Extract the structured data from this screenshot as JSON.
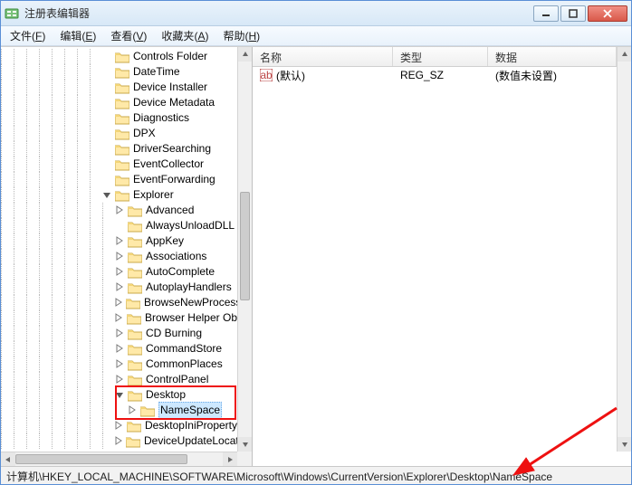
{
  "window": {
    "title": "注册表编辑器"
  },
  "menu": {
    "file": {
      "label": "文件",
      "key": "F"
    },
    "edit": {
      "label": "编辑",
      "key": "E"
    },
    "view": {
      "label": "查看",
      "key": "V"
    },
    "fav": {
      "label": "收藏夹",
      "key": "A"
    },
    "help": {
      "label": "帮助",
      "key": "H"
    }
  },
  "tree": {
    "root_indent": 8,
    "nodes": [
      {
        "depth": 8,
        "exp": "leaf",
        "label": "Controls Folder"
      },
      {
        "depth": 8,
        "exp": "leaf",
        "label": "DateTime"
      },
      {
        "depth": 8,
        "exp": "leaf",
        "label": "Device Installer"
      },
      {
        "depth": 8,
        "exp": "leaf",
        "label": "Device Metadata"
      },
      {
        "depth": 8,
        "exp": "leaf",
        "label": "Diagnostics"
      },
      {
        "depth": 8,
        "exp": "leaf",
        "label": "DPX"
      },
      {
        "depth": 8,
        "exp": "leaf",
        "label": "DriverSearching"
      },
      {
        "depth": 8,
        "exp": "leaf",
        "label": "EventCollector"
      },
      {
        "depth": 8,
        "exp": "leaf",
        "label": "EventForwarding"
      },
      {
        "depth": 8,
        "exp": "open",
        "label": "Explorer"
      },
      {
        "depth": 9,
        "exp": "closed",
        "label": "Advanced"
      },
      {
        "depth": 9,
        "exp": "leaf",
        "label": "AlwaysUnloadDLL"
      },
      {
        "depth": 9,
        "exp": "closed",
        "label": "AppKey"
      },
      {
        "depth": 9,
        "exp": "closed",
        "label": "Associations"
      },
      {
        "depth": 9,
        "exp": "closed",
        "label": "AutoComplete"
      },
      {
        "depth": 9,
        "exp": "closed",
        "label": "AutoplayHandlers"
      },
      {
        "depth": 9,
        "exp": "closed",
        "label": "BrowseNewProcess"
      },
      {
        "depth": 9,
        "exp": "closed",
        "label": "Browser Helper Ob"
      },
      {
        "depth": 9,
        "exp": "closed",
        "label": "CD Burning"
      },
      {
        "depth": 9,
        "exp": "closed",
        "label": "CommandStore"
      },
      {
        "depth": 9,
        "exp": "closed",
        "label": "CommonPlaces"
      },
      {
        "depth": 9,
        "exp": "closed",
        "label": "ControlPanel"
      },
      {
        "depth": 9,
        "exp": "open",
        "label": "Desktop",
        "redbox_start": true
      },
      {
        "depth": 10,
        "exp": "closed",
        "label": "NameSpace",
        "selected": true,
        "redbox_end": true
      },
      {
        "depth": 9,
        "exp": "closed",
        "label": "DesktopIniProperty"
      },
      {
        "depth": 9,
        "exp": "closed",
        "label": "DeviceUpdateLocati"
      }
    ]
  },
  "columns": {
    "name": "名称",
    "type": "类型",
    "data": "数据"
  },
  "values": [
    {
      "icon": "ab",
      "name": "(默认)",
      "type": "REG_SZ",
      "data": "(数值未设置)"
    }
  ],
  "statusbar": {
    "path": "计算机\\HKEY_LOCAL_MACHINE\\SOFTWARE\\Microsoft\\Windows\\CurrentVersion\\Explorer\\Desktop\\NameSpace"
  }
}
